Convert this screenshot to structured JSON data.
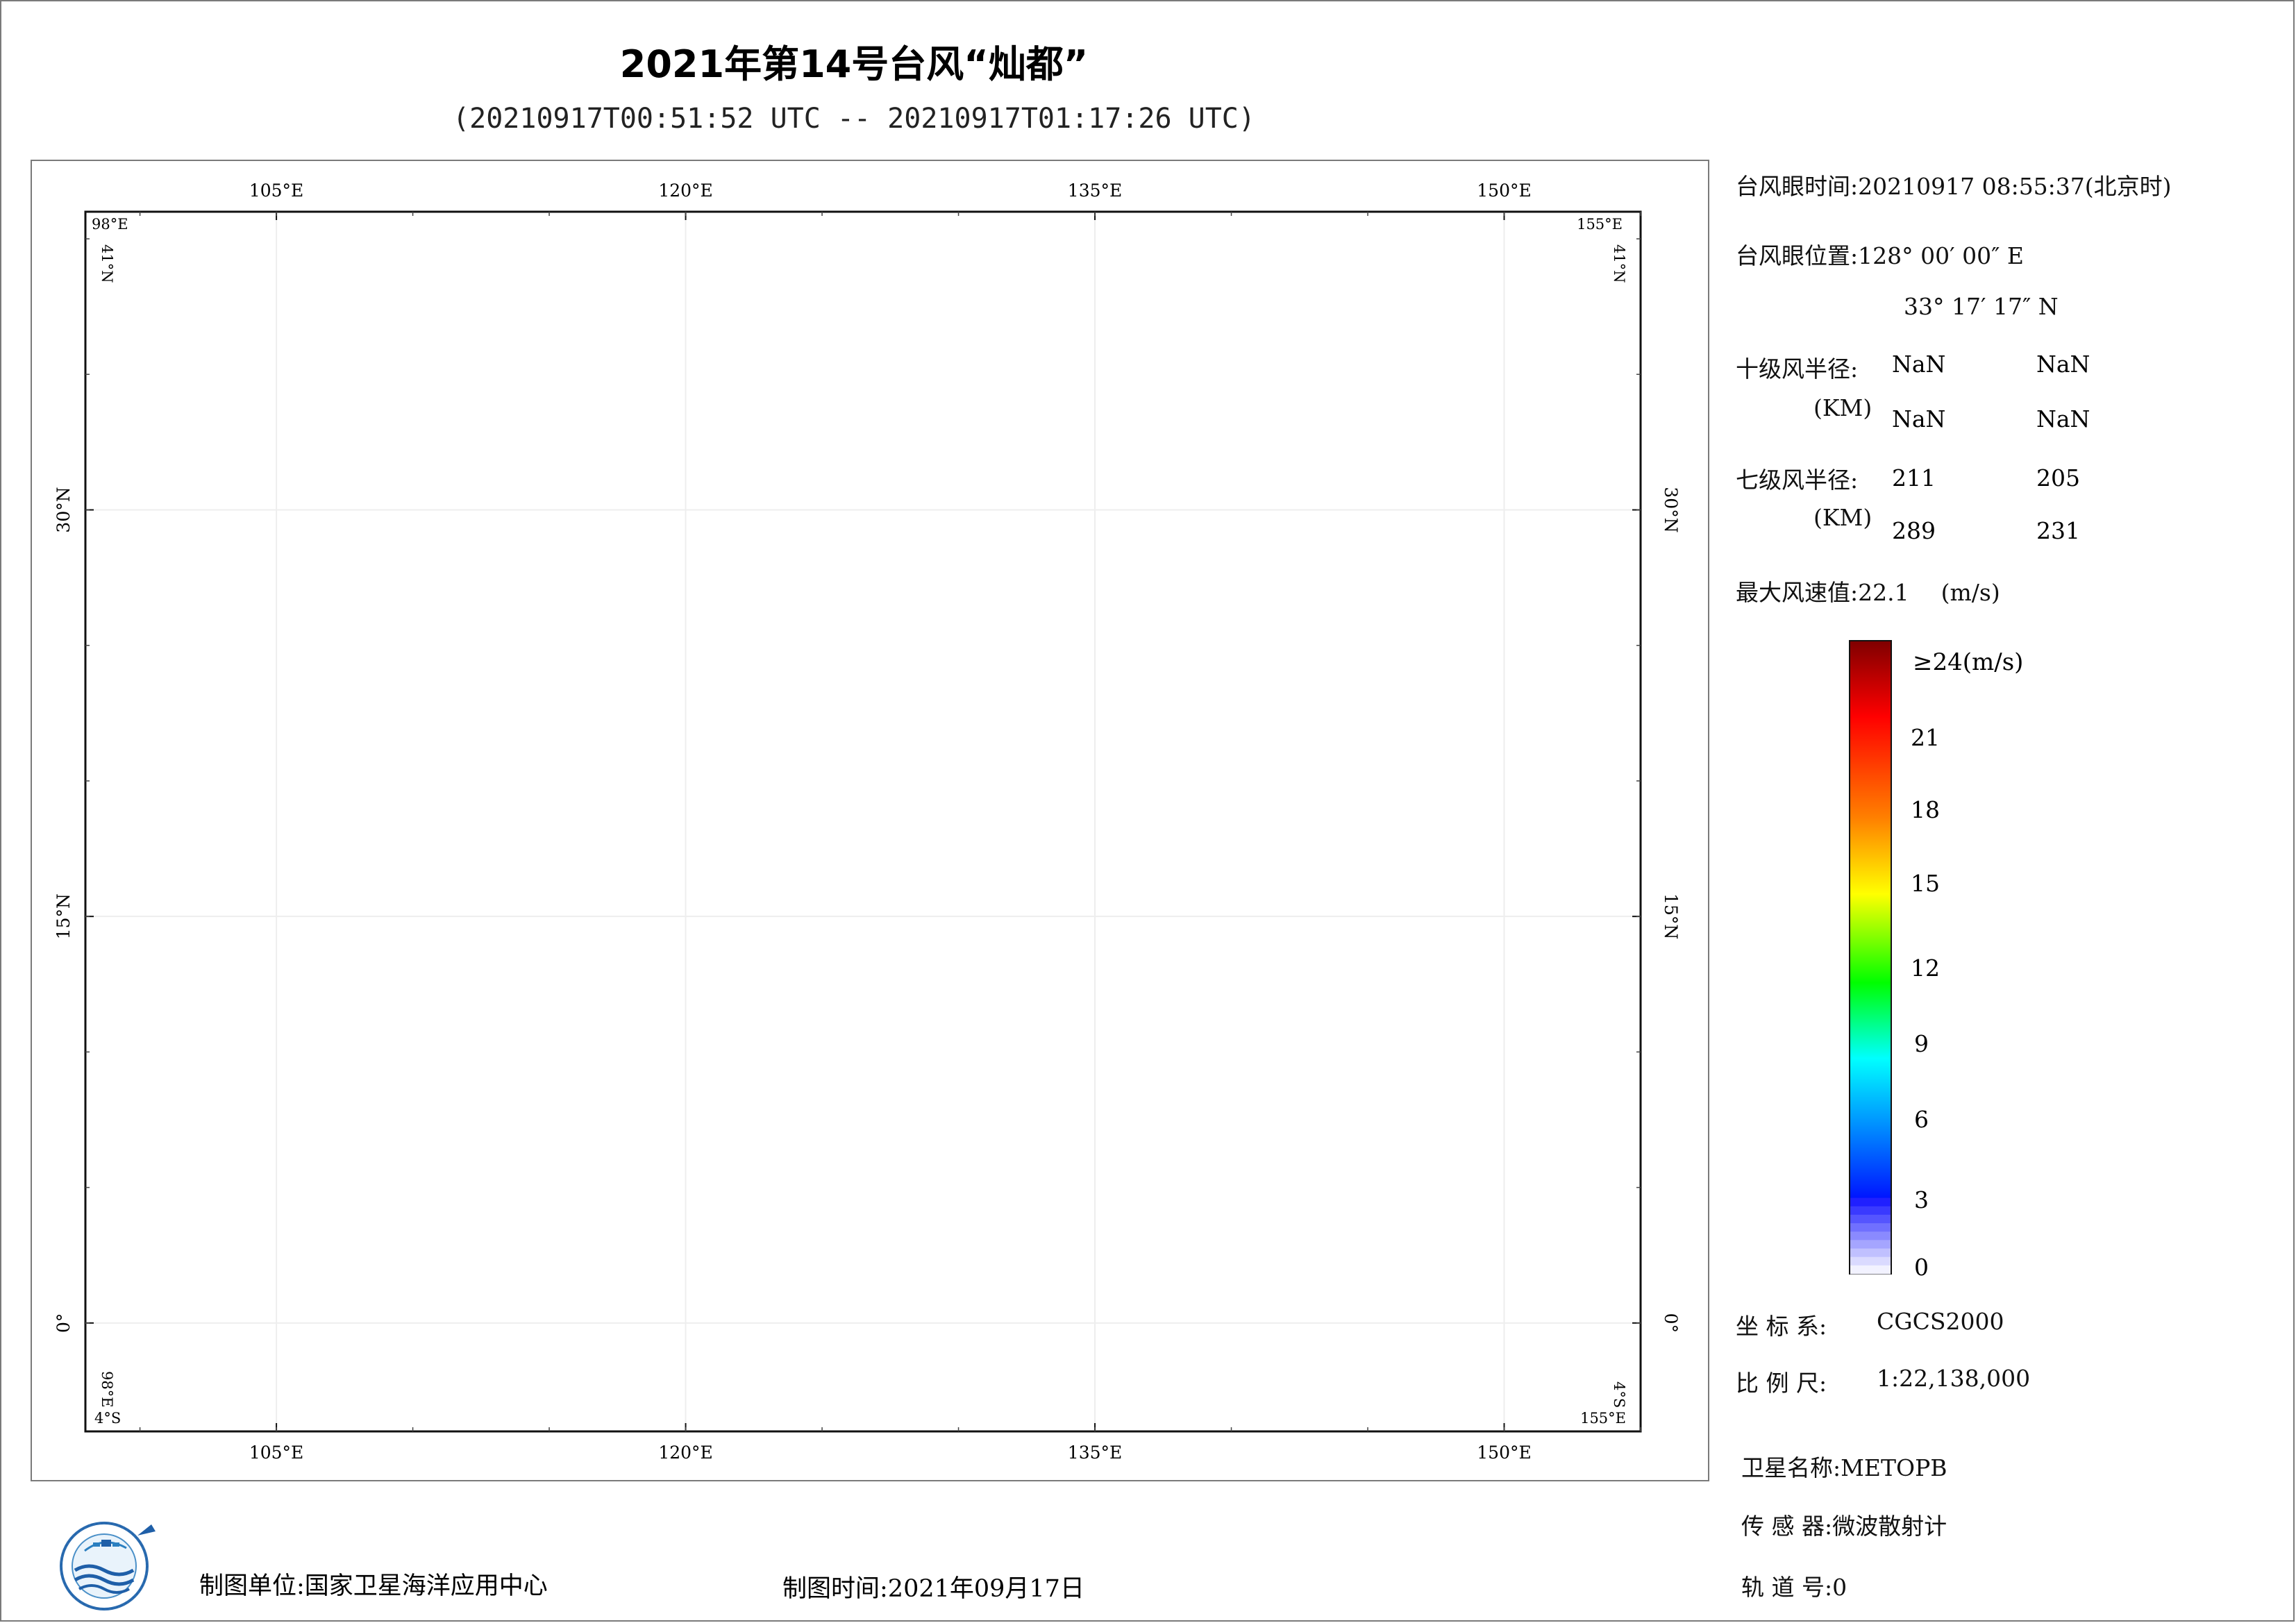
{
  "title": "2021年第14号台风“灿都”",
  "subtitle": "(20210917T00:51:52 UTC -- 20210917T01:17:26 UTC)",
  "map": {
    "lon_top_labels": [
      "105°E",
      "120°E",
      "135°E",
      "150°E"
    ],
    "lon_bottom_labels": [
      "105°E",
      "120°E",
      "135°E",
      "150°E"
    ],
    "lat_left_labels": [
      "30°N",
      "15°N",
      "0°"
    ],
    "lat_right_labels": [
      "30°N",
      "15°N",
      "0°"
    ],
    "corner_tl_lon": "98°E",
    "corner_tl_lat": "41°N",
    "corner_tr_lon": "155°E",
    "corner_tr_lat": "41°N",
    "corner_bl_lon": "98°E",
    "corner_bl_lat": "4°S",
    "corner_br_lon": "155°E",
    "corner_br_lat": "4°S",
    "extent": {
      "lon_min": 98,
      "lon_max": 155,
      "lat_min": -4,
      "lat_max": 41
    },
    "grid_lons": [
      105,
      120,
      135,
      150
    ],
    "grid_lats": [
      30,
      15,
      0
    ],
    "grid": true
  },
  "info": {
    "eye_time_label": "台风眼时间:",
    "eye_time_value": "20210917 08:55:37(北京时)",
    "eye_pos_label": "台风眼位置:",
    "eye_lon": "128° 00′ 00″ E",
    "eye_lat": "33° 17′ 17″ N",
    "r10_label": "十级风半径:",
    "r10_unit": "(KM)",
    "r10_values": [
      "NaN",
      "NaN",
      "NaN",
      "NaN"
    ],
    "r7_label": "七级风半径:",
    "r7_unit": "(KM)",
    "r7_values": [
      "211",
      "205",
      "289",
      "231"
    ],
    "max_wind_label": "最大风速值:",
    "max_wind_value": "22.1",
    "max_wind_unit": "(m/s)"
  },
  "colorbar": {
    "top_label": "≥24(m/s)",
    "ticks": [
      "21",
      "18",
      "15",
      "12",
      "9",
      "6",
      "3",
      "0"
    ],
    "colors": [
      "#7f0000",
      "#ff0000",
      "#ff8000",
      "#ffff00",
      "#00ff00",
      "#00ffff",
      "#0080ff",
      "#0000ff",
      "#ffffff"
    ]
  },
  "meta": {
    "crs_label": "坐 标 系:",
    "crs_value": "CGCS2000",
    "scale_label": "比 例 尺:",
    "scale_value": "1:22,138,000",
    "satellite_label": "卫星名称:",
    "satellite_value": "METOPB",
    "sensor_label": "传 感 器:",
    "sensor_value": "微波散射计",
    "orbit_label": "轨 道 号:",
    "orbit_value": "0"
  },
  "footer": {
    "unit_label": "制图单位:",
    "unit_value": "国家卫星海洋应用中心",
    "time_label": "制图时间:",
    "time_value": "2021年09月17日"
  }
}
